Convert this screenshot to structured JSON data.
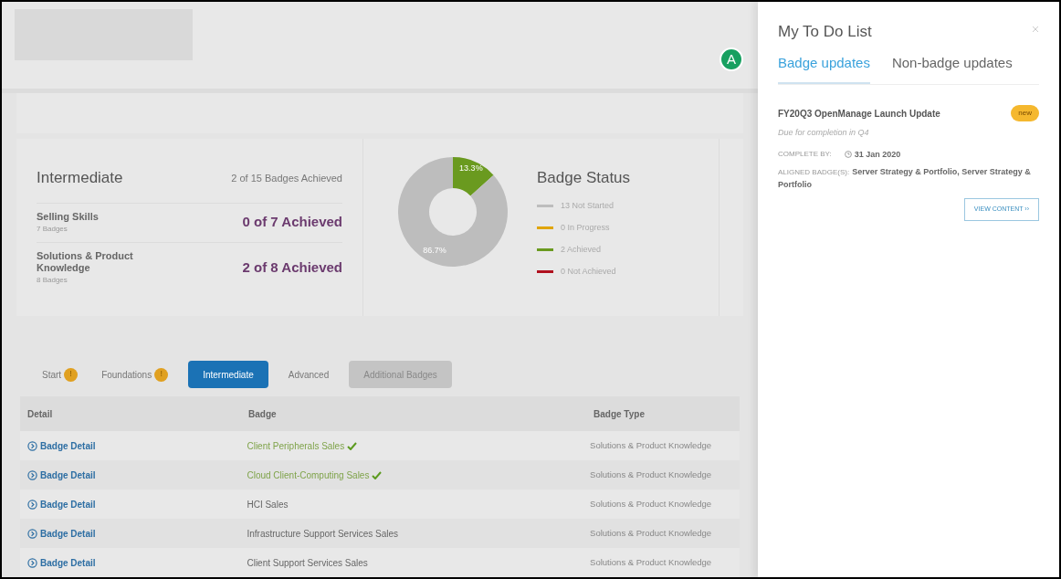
{
  "summary": {
    "level_title": "Intermediate",
    "achieved_total": "2 of 15 Badges Achieved",
    "categories": [
      {
        "name": "Selling Skills",
        "count": "7 Badges",
        "achieved": "0 of 7 Achieved"
      },
      {
        "name": "Solutions & Product Knowledge",
        "count": "8 Badges",
        "achieved": "2 of 8 Achieved"
      }
    ]
  },
  "badge_status": {
    "title": "Badge Status",
    "chart_data": {
      "type": "donut",
      "values": [
        13.3,
        86.7
      ],
      "colors": [
        "#6a9a1f",
        "#bdbdbd"
      ],
      "value_labels": [
        "13.3%",
        "86.7%"
      ]
    },
    "legend": [
      {
        "label": "13 Not Started",
        "color": "#bdbdbd"
      },
      {
        "label": "0 In Progress",
        "color": "#e0a500"
      },
      {
        "label": "2 Achieved",
        "color": "#6a9a1f"
      },
      {
        "label": "0 Not Achieved",
        "color": "#b0101e"
      }
    ]
  },
  "level_tabs": [
    {
      "label": "Start",
      "badge": "!",
      "selected": false,
      "disabled": false
    },
    {
      "label": "Foundations",
      "badge": "!",
      "selected": false,
      "disabled": false
    },
    {
      "label": "Intermediate",
      "selected": true,
      "disabled": false
    },
    {
      "label": "Advanced",
      "selected": false,
      "disabled": false
    },
    {
      "label": "Additional Badges",
      "selected": false,
      "disabled": true
    }
  ],
  "table": {
    "columns": [
      "Detail",
      "Badge",
      "Badge Type"
    ],
    "rows": [
      {
        "detail": "Badge Detail",
        "badge": "Client Peripherals Sales",
        "achieved": true,
        "type": "Solutions & Product Knowledge"
      },
      {
        "detail": "Badge Detail",
        "badge": "Cloud Client-Computing Sales",
        "achieved": true,
        "type": "Solutions & Product Knowledge"
      },
      {
        "detail": "Badge Detail",
        "badge": "HCI Sales",
        "achieved": false,
        "type": "Solutions & Product Knowledge"
      },
      {
        "detail": "Badge Detail",
        "badge": "Infrastructure Support Services Sales",
        "achieved": false,
        "type": "Solutions & Product Knowledge"
      },
      {
        "detail": "Badge Detail",
        "badge": "Client Support Services Sales",
        "achieved": false,
        "type": "Solutions & Product Knowledge"
      }
    ]
  },
  "todo_panel": {
    "title": "My To Do List",
    "callout": "A",
    "tabs": [
      {
        "label": "Badge updates",
        "selected": true
      },
      {
        "label": "Non-badge updates",
        "selected": false
      }
    ],
    "items": [
      {
        "title": "FY20Q3 OpenManage Launch Update",
        "tag": "new",
        "subtitle": "Due for completion in Q4",
        "complete_by_label": "COMPLETE BY:",
        "complete_by": "31 Jan 2020",
        "aligned_label": "ALIGNED BADGE(S):",
        "aligned": "Server Strategy & Portfolio, Server Strategy & Portfolio",
        "action": "VIEW CONTENT ››"
      }
    ]
  }
}
